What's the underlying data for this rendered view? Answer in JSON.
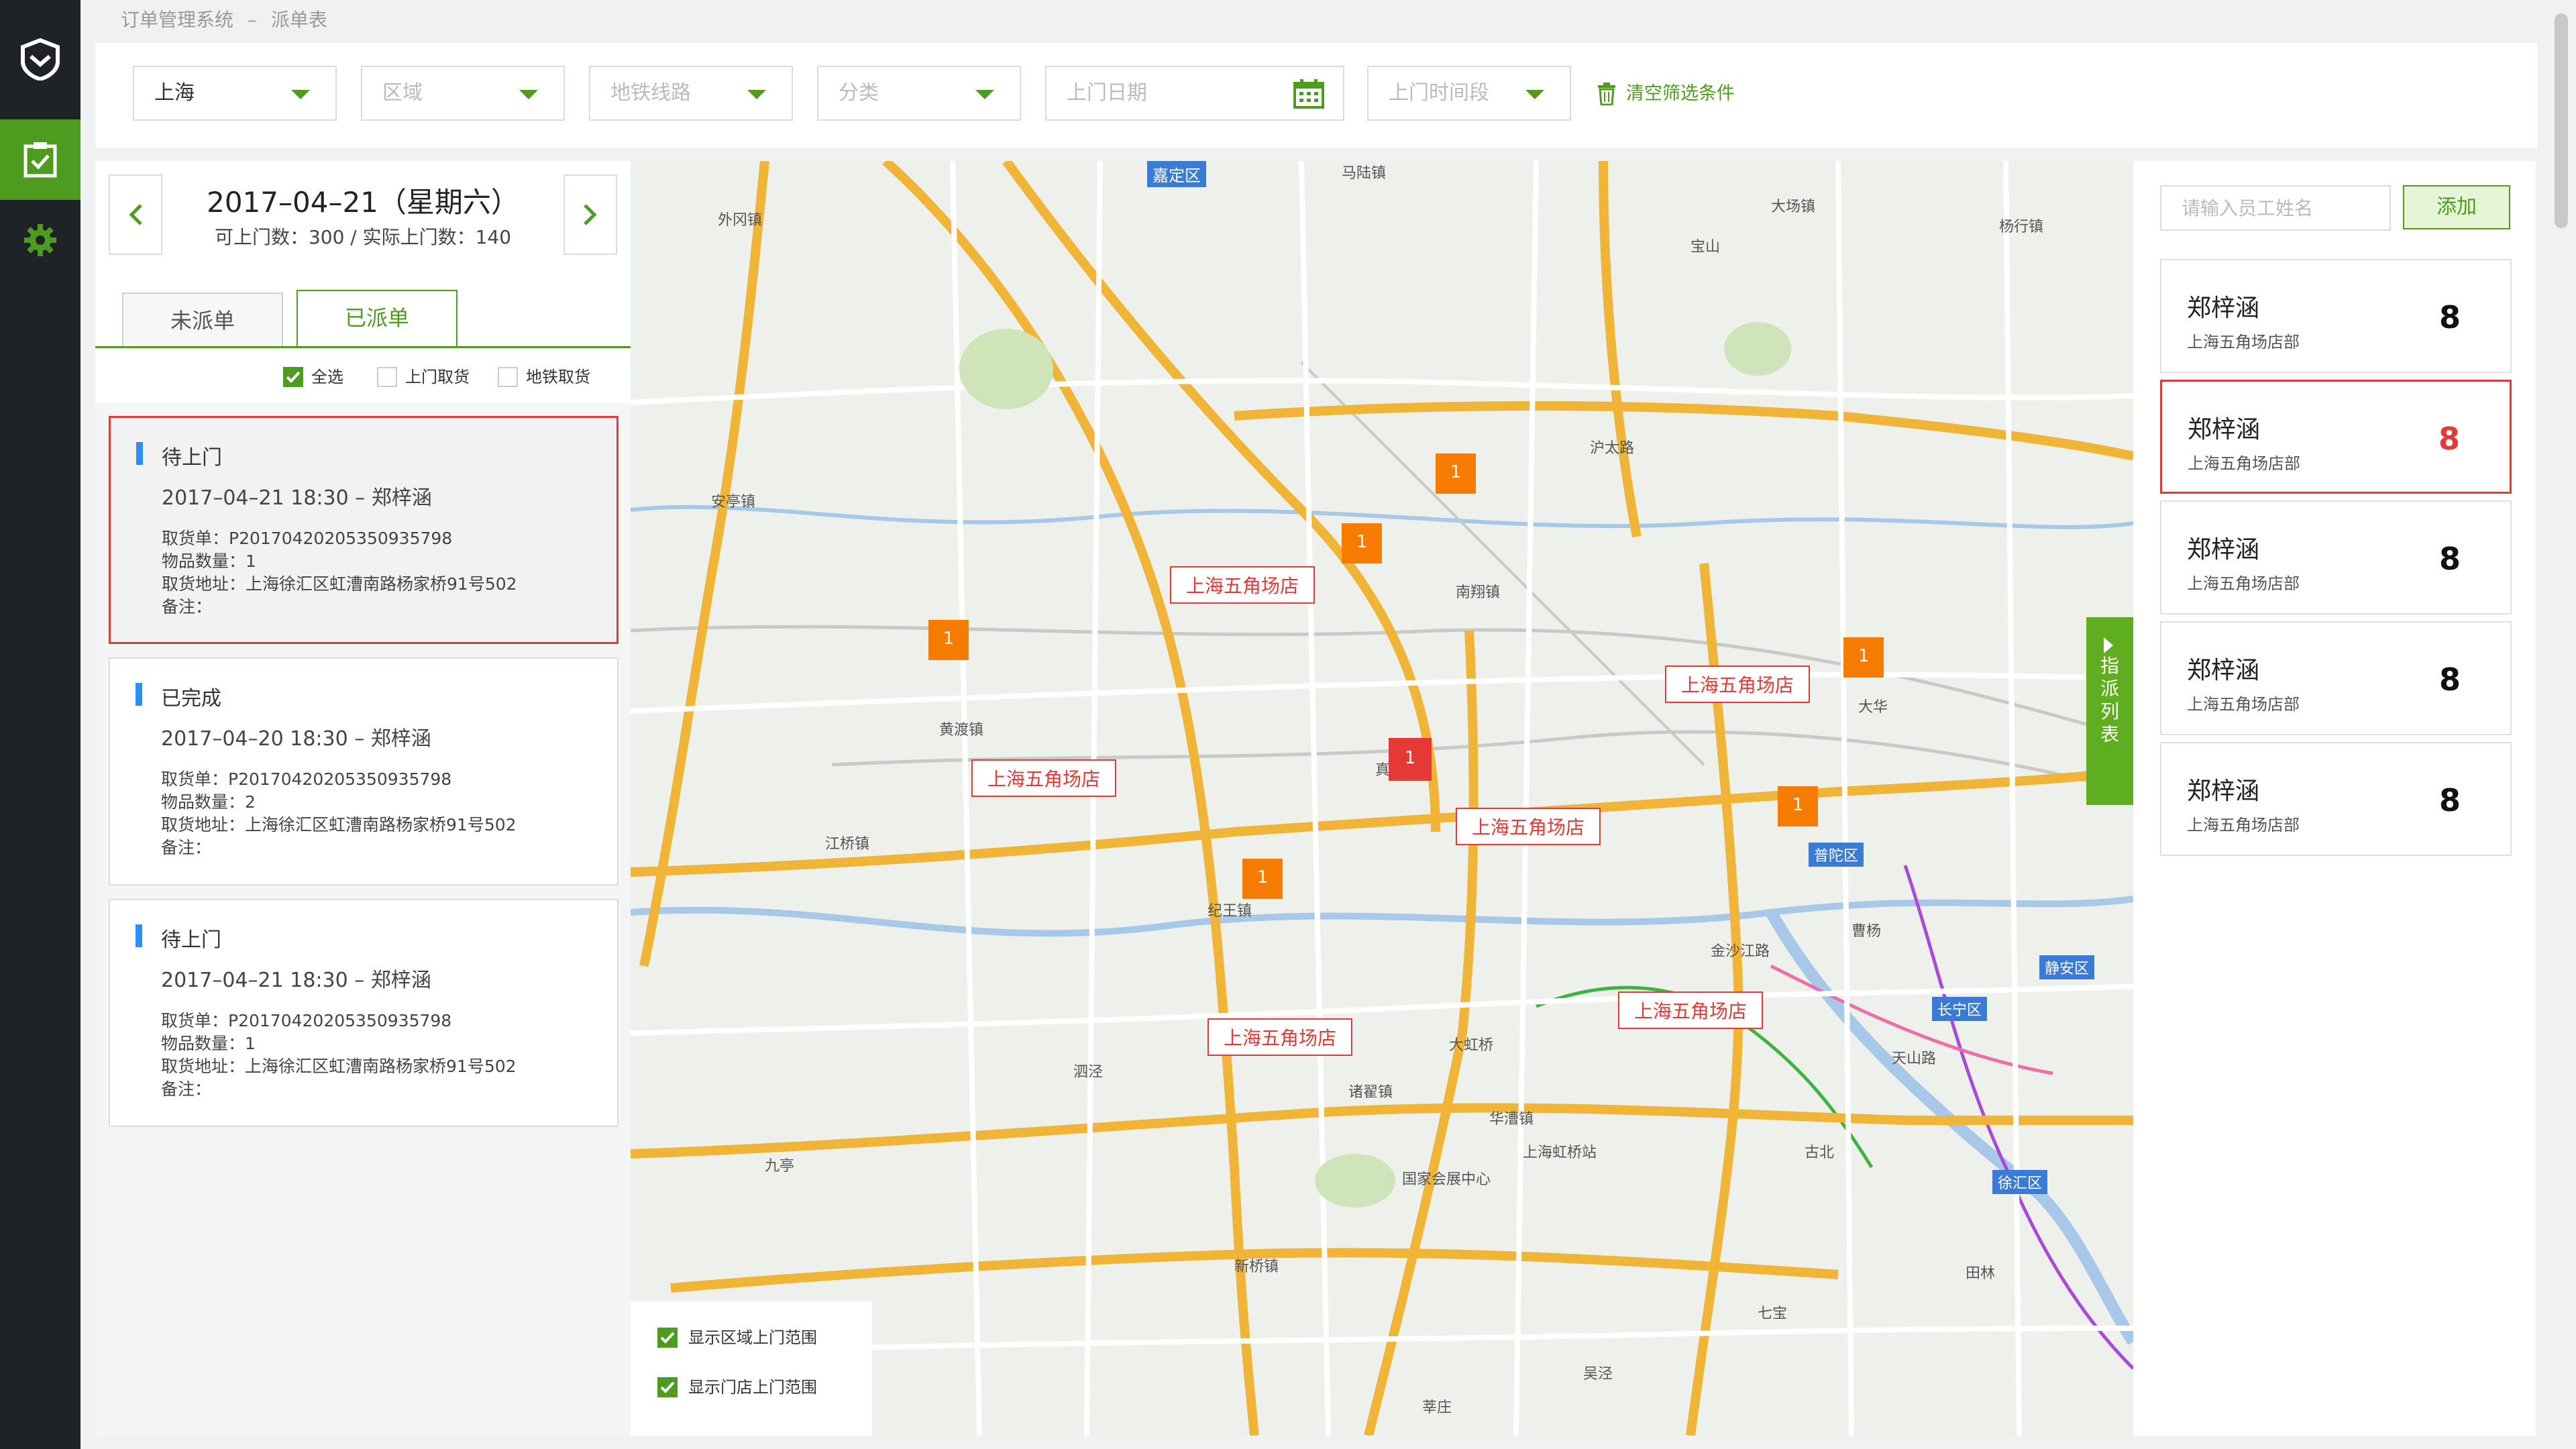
{
  "breadcrumb": {
    "system": "订单管理系统",
    "sep": "–",
    "page": "派单表"
  },
  "nav": {
    "items": [
      "logo",
      "dispatch",
      "settings"
    ]
  },
  "filters": {
    "city": "上海",
    "district_placeholder": "区域",
    "metro_placeholder": "地铁线路",
    "category_placeholder": "分类",
    "date_placeholder": "上门日期",
    "timeslot_placeholder": "上门时间段",
    "clear_label": "清空筛选条件"
  },
  "dayhead": {
    "date": "2017–04–21（星期六）",
    "stats": "可上门数：300  /  实际上门数：140"
  },
  "tabs": {
    "pending": "未派单",
    "assigned": "已派单"
  },
  "checks": {
    "all": "全选",
    "home": "上门取货",
    "metro": "地铁取货"
  },
  "orders": [
    {
      "status": "待上门",
      "datetime": "2017–04–21  18:30 – 郑梓涵",
      "order_no": "取货单：P20170420205350935798",
      "qty": "物品数量：1",
      "address": "取货地址：上海徐汇区虹漕南路杨家桥91号502",
      "note": "备注："
    },
    {
      "status": "已完成",
      "datetime": "2017–04–20  18:30 – 郑梓涵",
      "order_no": "取货单：P20170420205350935798",
      "qty": "物品数量：2",
      "address": "取货地址：上海徐汇区虹漕南路杨家桥91号502",
      "note": "备注："
    },
    {
      "status": "待上门",
      "datetime": "2017–04–21  18:30 – 郑梓涵",
      "order_no": "取货单：P20170420205350935798",
      "qty": "物品数量：1",
      "address": "取货地址：上海徐汇区虹漕南路杨家桥91号502",
      "note": "备注："
    }
  ],
  "map": {
    "store_label": "上海五角场店",
    "marker_count": "1",
    "places": [
      "嘉定区",
      "马陆镇",
      "外冈镇",
      "安亭镇",
      "黄渡镇",
      "南翔镇",
      "江桥镇",
      "大场镇",
      "华漕镇",
      "七宝",
      "普陀区",
      "长宁区",
      "静安区",
      "徐汇区",
      "大华",
      "真如镇",
      "纪王镇",
      "诸翟镇",
      "新桥镇",
      "泗泾",
      "九亭",
      "大虹桥",
      "上海虹桥站",
      "国家会展中心",
      "吴泾",
      "莘庄",
      "沪太路",
      "宝山",
      "杨行镇",
      "曹杨",
      "金沙江路",
      "天山路",
      "古北",
      "田林"
    ],
    "options": {
      "district_range": "显示区域上门范围",
      "store_range": "显示门店上门范围"
    }
  },
  "dispatch_tab": "指派列表",
  "staff": {
    "search_placeholder": "请输入员工姓名",
    "add_label": "添加",
    "list": [
      {
        "name": "郑梓涵",
        "store": "上海五角场店部",
        "count": "8"
      },
      {
        "name": "郑梓涵",
        "store": "上海五角场店部",
        "count": "8"
      },
      {
        "name": "郑梓涵",
        "store": "上海五角场店部",
        "count": "8"
      },
      {
        "name": "郑梓涵",
        "store": "上海五角场店部",
        "count": "8"
      },
      {
        "name": "郑梓涵",
        "store": "上海五角场店部",
        "count": "8"
      }
    ]
  },
  "colors": {
    "brand": "#4d9b1f",
    "selected": "#e53935",
    "nav": "#1f2327",
    "marker": "#f57c00"
  }
}
